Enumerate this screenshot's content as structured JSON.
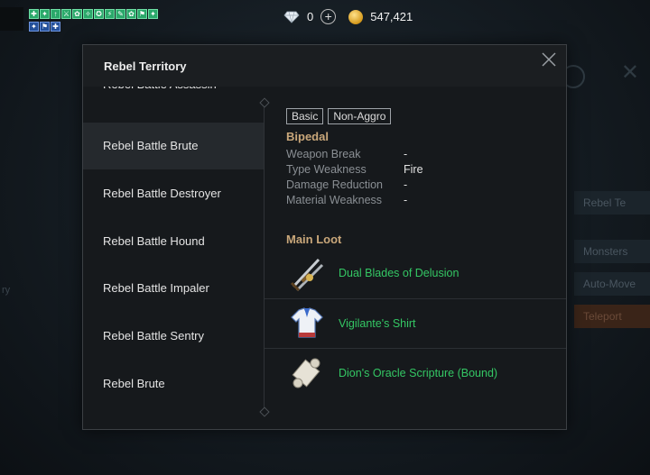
{
  "hud": {
    "gem_count": "0",
    "gold_amount": "547,421",
    "buffs_row1": [
      "✚",
      "✦",
      "↑",
      "⚔",
      "✿",
      "✧",
      "✪",
      "⚡",
      "✎",
      "✿",
      "⚑",
      "✦"
    ],
    "buffs_row2": [
      "✦",
      "⚑",
      "✚"
    ]
  },
  "background": {
    "right_panel_items": [
      "Rebel Te",
      "Monsters",
      "Auto-Move",
      "Teleport"
    ],
    "left_fragment": "ry"
  },
  "dialog": {
    "title": "Rebel Territory",
    "monsters": [
      {
        "label": "Rebel Battle Assassin",
        "selected": false
      },
      {
        "label": "Rebel Battle Brute",
        "selected": true
      },
      {
        "label": "Rebel Battle Destroyer",
        "selected": false
      },
      {
        "label": "Rebel Battle Hound",
        "selected": false
      },
      {
        "label": "Rebel Battle Impaler",
        "selected": false
      },
      {
        "label": "Rebel Battle Sentry",
        "selected": false
      },
      {
        "label": "Rebel Brute",
        "selected": false
      }
    ],
    "detail": {
      "tags": [
        "Basic",
        "Non-Aggro"
      ],
      "category": "Bipedal",
      "properties": [
        {
          "name": "Weapon Break",
          "value": "-"
        },
        {
          "name": "Type Weakness",
          "value": "Fire"
        },
        {
          "name": "Damage Reduction",
          "value": "-"
        },
        {
          "name": "Material Weakness",
          "value": "-"
        }
      ],
      "loot_title": "Main Loot",
      "loot": [
        {
          "name": "Dual Blades of Delusion",
          "icon": "dual-blades-icon"
        },
        {
          "name": "Vigilante's Shirt",
          "icon": "shirt-icon"
        },
        {
          "name": "Dion's Oracle Scripture (Bound)",
          "icon": "scroll-icon"
        }
      ]
    }
  },
  "colors": {
    "loot_green": "#34c764",
    "section_gold": "#c9a77a",
    "dialog_bg": "#16191c"
  }
}
